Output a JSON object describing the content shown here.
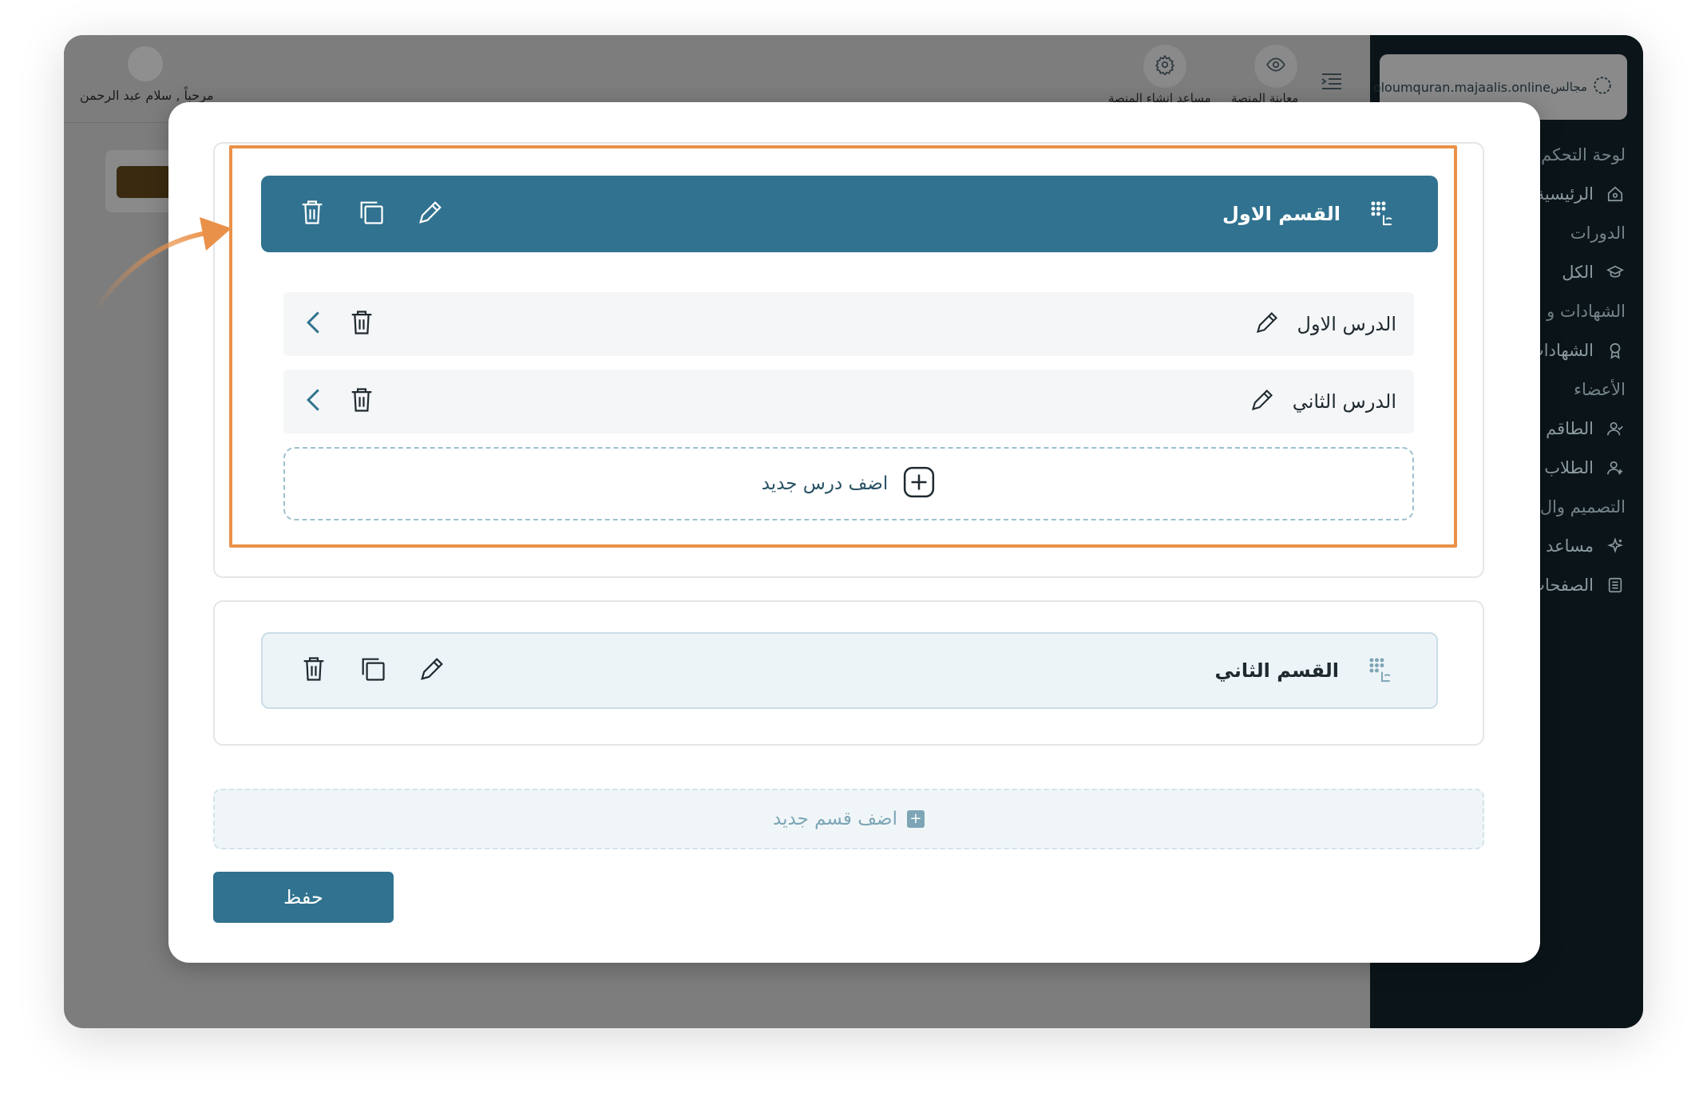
{
  "app": {
    "sidebar": {
      "domain": "oloumquran.majaalis.online",
      "brand": "مجالس",
      "nav": [
        {
          "label": "لوحة التحكم",
          "type": "section",
          "icon": ""
        },
        {
          "label": "الرئيسية",
          "type": "item",
          "icon": "home-icon"
        },
        {
          "label": "الدورات",
          "type": "section",
          "icon": ""
        },
        {
          "label": "الكل",
          "type": "item",
          "icon": "graduation-cap-icon"
        },
        {
          "label": "الشهادات و",
          "type": "section",
          "icon": ""
        },
        {
          "label": "الشهادات",
          "type": "item",
          "icon": "award-icon"
        },
        {
          "label": "الأعضاء",
          "type": "section",
          "icon": ""
        },
        {
          "label": "الطاقم",
          "type": "item",
          "icon": "user-check-icon"
        },
        {
          "label": "الطلاب",
          "type": "item",
          "icon": "user-plus-icon"
        },
        {
          "label": "التصميم وال",
          "type": "section",
          "icon": ""
        },
        {
          "label": "مساعد",
          "type": "item",
          "icon": "sparkles-icon"
        },
        {
          "label": "الصفحات",
          "type": "item",
          "icon": "page-icon"
        }
      ]
    },
    "header": {
      "welcome": "مرحباً , سلام عبد الرحمن",
      "preview_label": "معاينة المنصة",
      "wizard_label": "مساعد إنشاء المنصة"
    }
  },
  "modal": {
    "sections": [
      {
        "title": "القسم الاول",
        "lessons": [
          {
            "name": "الدرس الاول"
          },
          {
            "name": "الدرس الثاني"
          }
        ],
        "add_lesson_label": "اضف درس جديد"
      },
      {
        "title": "القسم الثاني"
      }
    ],
    "add_section_label": "اضف قسم جديد",
    "save_label": "حفظ"
  },
  "colors": {
    "primary": "#30728f",
    "highlight": "#ea9149",
    "sidebar_bg": "#0b1519"
  }
}
